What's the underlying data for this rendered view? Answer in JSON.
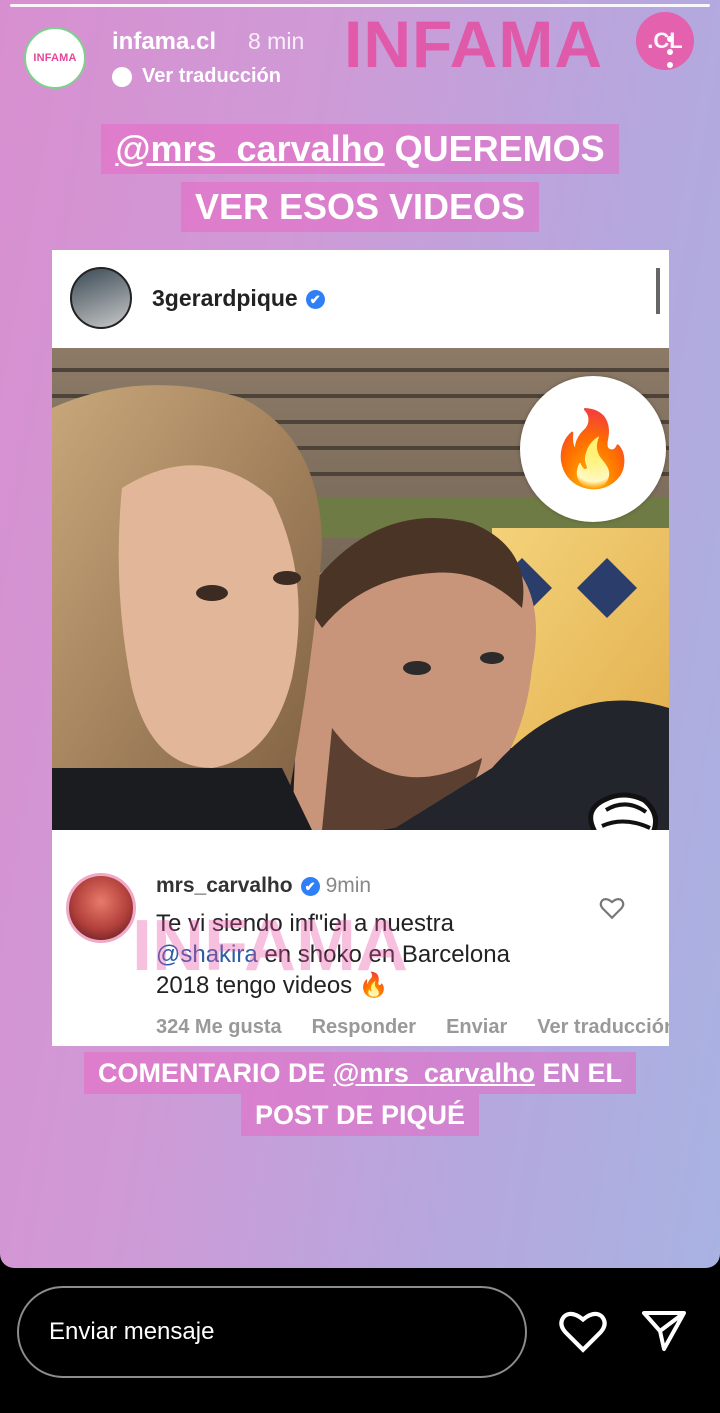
{
  "story": {
    "account": "infama.cl",
    "avatar_text": "INFAMA",
    "time": "8 min",
    "translate_label": "Ver traducción",
    "brand": "INFAMA",
    "brand_badge": ".CL"
  },
  "caption_top": {
    "mention": "@mrs_carvalho",
    "line1_rest": " QUEREMOS",
    "line2": "VER ESOS VIDEOS"
  },
  "post": {
    "username": "3gerardpique",
    "verified_mark": "✔",
    "reaction_emoji": "🔥",
    "comment": {
      "username": "mrs_carvalho",
      "time": "9min",
      "text_1": "Te vi siendo inf\"iel a nuestra",
      "mention": "@shakira",
      "text_2": " en shoko en Barcelona",
      "text_3": "2018 tengo videos 🔥",
      "likes": "324 Me gusta",
      "reply": "Responder",
      "send": "Enviar",
      "see_translation": "Ver traducción"
    }
  },
  "caption_bottom": {
    "prefix": "COMENTARIO DE ",
    "mention": "@mrs_carvalho",
    "suffix": " EN EL",
    "line2": "POST DE PIQUÉ"
  },
  "footer": {
    "message_placeholder": "Enviar mensaje",
    "like_icon": "heart-outline-icon",
    "send_icon": "paper-plane-icon"
  },
  "colors": {
    "brand_pink": "#e64ea2",
    "verified_blue": "#2f7ff7",
    "background_gradient_start": "#d88fd0",
    "background_gradient_end": "#a8b3e2"
  }
}
